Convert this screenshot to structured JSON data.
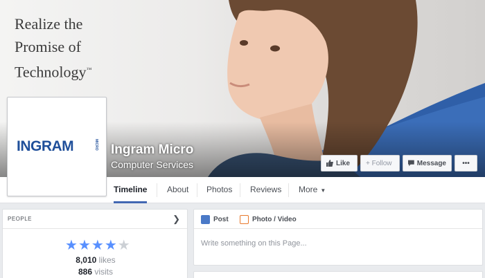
{
  "cover": {
    "tagline": [
      "Realize the",
      "Promise of",
      "Technology"
    ],
    "tagline_mark": "™"
  },
  "profile": {
    "logo_text": "INGRAM",
    "logo_sub": "MICRO",
    "name": "Ingram Micro",
    "category": "Computer Services"
  },
  "actions": {
    "like": "Like",
    "follow": "+ Follow",
    "message": "Message",
    "more": "•••"
  },
  "tabs": [
    {
      "label": "Timeline",
      "active": true
    },
    {
      "label": "About"
    },
    {
      "label": "Photos"
    },
    {
      "label": "Reviews"
    },
    {
      "label": "More"
    }
  ],
  "people": {
    "title": "PEOPLE",
    "rating": 4,
    "rating_max": 5,
    "likes_count": "8,010",
    "likes_label": "likes",
    "visits_count": "886",
    "visits_label": "visits"
  },
  "composer": {
    "post_label": "Post",
    "photo_label": "Photo / Video",
    "placeholder": "Write something on this Page..."
  },
  "colors": {
    "brand_blue": "#1f4f9a",
    "tab_underline": "#4267b2",
    "star_on": "#5890ff",
    "star_off": "#ccd0d5"
  }
}
